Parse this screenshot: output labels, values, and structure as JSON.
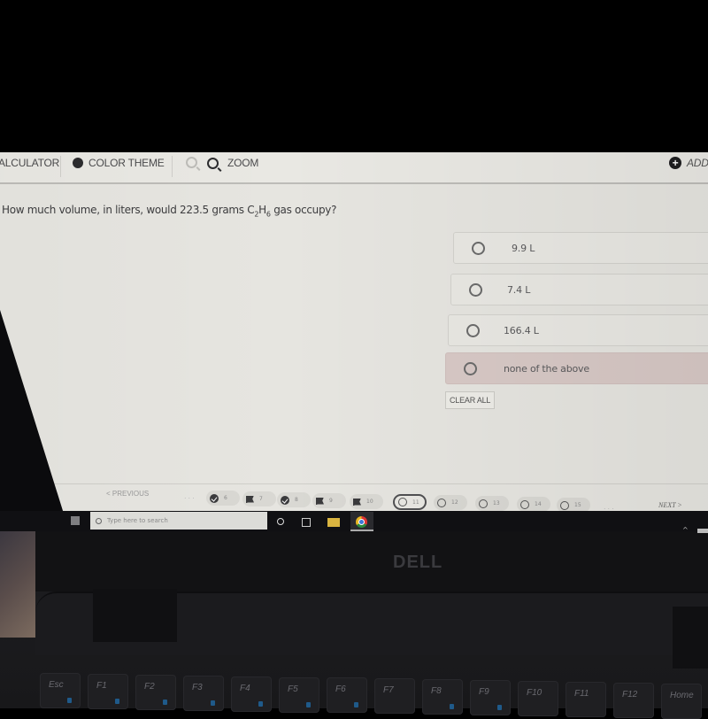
{
  "toolbar": {
    "calculator_label": "ALCULATOR",
    "color_theme_label": "COLOR THEME",
    "zoom_label": "ZOOM",
    "add_label": "ADD"
  },
  "question": {
    "prefix": "How much volume, in liters, would 223.5 grams C",
    "sub1": "2",
    "mid": "H",
    "sub2": "6",
    "suffix": " gas occupy?"
  },
  "options": [
    {
      "label": "9.9 L",
      "selected": false
    },
    {
      "label": "7.4 L",
      "selected": false
    },
    {
      "label": "166.4 L",
      "selected": false
    },
    {
      "label": "none of the above",
      "selected": true
    }
  ],
  "clear_all_label": "CLEAR ALL",
  "navigation": {
    "previous_label": "< PREVIOUS",
    "next_label": "NEXT >",
    "ellipsis": "...",
    "questions": [
      {
        "number": "6",
        "status": "answered"
      },
      {
        "number": "7",
        "status": "flagged"
      },
      {
        "number": "8",
        "status": "answered"
      },
      {
        "number": "9",
        "status": "flagged"
      },
      {
        "number": "10",
        "status": "flagged"
      },
      {
        "number": "11",
        "status": "current"
      },
      {
        "number": "12",
        "status": "unanswered"
      },
      {
        "number": "13",
        "status": "unanswered"
      },
      {
        "number": "14",
        "status": "unanswered"
      },
      {
        "number": "15",
        "status": "unanswered"
      }
    ]
  },
  "taskbar": {
    "search_placeholder": "Type here to search"
  },
  "laptop": {
    "brand": "DELL",
    "keys": [
      "Esc",
      "F1",
      "F2",
      "F3",
      "F4",
      "F5",
      "F6",
      "F7",
      "F8",
      "F9",
      "F10",
      "F11",
      "F12",
      "Home"
    ]
  }
}
